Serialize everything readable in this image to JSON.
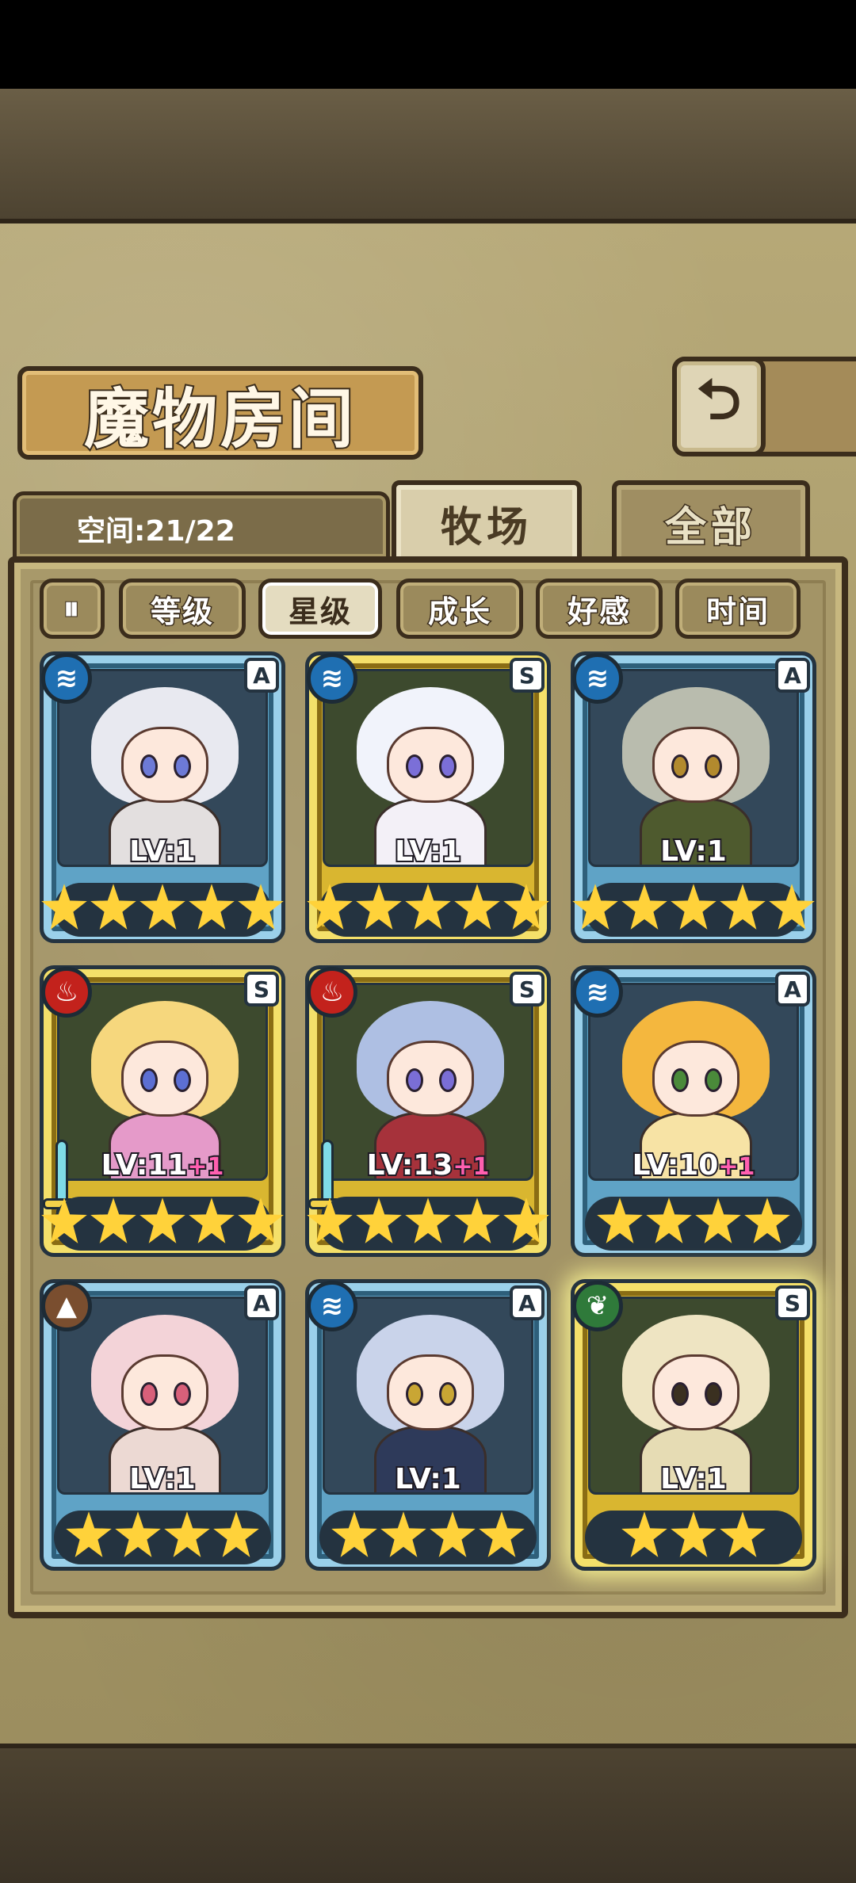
{
  "screen": {
    "title": "魔物房间",
    "back_icon": "back-arrow-icon"
  },
  "capacity": {
    "label": "空间:21/22"
  },
  "tabs": [
    {
      "label": "牧场",
      "active": true
    },
    {
      "label": "全部",
      "active": false
    }
  ],
  "sort": {
    "order_icon": "sort-order-icon",
    "order_glyph": "⏸",
    "buttons": [
      {
        "label": "等级",
        "active": false
      },
      {
        "label": "星级",
        "active": true
      },
      {
        "label": "成长",
        "active": false
      },
      {
        "label": "好感",
        "active": false
      },
      {
        "label": "时间",
        "active": false
      }
    ]
  },
  "monsters": [
    {
      "level": "LV:1",
      "bonus": "",
      "stars": 5,
      "rank": "A",
      "element": "water",
      "element_glyph": "≋",
      "frame": "blue",
      "has_weapon": false,
      "hair_color": "#e8e9f0",
      "outfit_color": "#e3dfdf",
      "eye_color": "#6d7ad6"
    },
    {
      "level": "LV:1",
      "bonus": "",
      "stars": 5,
      "rank": "S",
      "element": "water",
      "element_glyph": "≋",
      "frame": "gold",
      "has_weapon": false,
      "hair_color": "#f1f3fb",
      "outfit_color": "#f3f0f7",
      "eye_color": "#7b6fd8"
    },
    {
      "level": "LV:1",
      "bonus": "",
      "stars": 5,
      "rank": "A",
      "element": "water",
      "element_glyph": "≋",
      "frame": "blue",
      "has_weapon": false,
      "hair_color": "#b9bcae",
      "outfit_color": "#4e5a2e",
      "eye_color": "#b28a2e"
    },
    {
      "level": "LV:11",
      "bonus": "+1",
      "stars": 5,
      "rank": "S",
      "element": "fire",
      "element_glyph": "♨",
      "frame": "gold",
      "has_weapon": true,
      "hair_color": "#f6d77d",
      "outfit_color": "#e59ac9",
      "eye_color": "#5c6fd3"
    },
    {
      "level": "LV:13",
      "bonus": "+1",
      "stars": 5,
      "rank": "S",
      "element": "fire",
      "element_glyph": "♨",
      "frame": "gold",
      "has_weapon": true,
      "hair_color": "#aebfe3",
      "outfit_color": "#a6323b",
      "eye_color": "#7a6ed6"
    },
    {
      "level": "LV:10",
      "bonus": "+1",
      "stars": 4,
      "rank": "A",
      "element": "water",
      "element_glyph": "≋",
      "frame": "blue",
      "has_weapon": false,
      "hair_color": "#f4b73e",
      "outfit_color": "#f7e3a5",
      "eye_color": "#4a8a3a"
    },
    {
      "level": "LV:1",
      "bonus": "",
      "stars": 4,
      "rank": "A",
      "element": "earth",
      "element_glyph": "▲",
      "frame": "blue",
      "has_weapon": false,
      "hair_color": "#f3d3d8",
      "outfit_color": "#ecd9d3",
      "eye_color": "#d8607a"
    },
    {
      "level": "LV:1",
      "bonus": "",
      "stars": 4,
      "rank": "A",
      "element": "water",
      "element_glyph": "≋",
      "frame": "blue",
      "has_weapon": false,
      "hair_color": "#c9d3ea",
      "outfit_color": "#2e3a5a",
      "eye_color": "#c9a634"
    },
    {
      "level": "LV:1",
      "bonus": "",
      "stars": 3,
      "rank": "S",
      "element": "wood",
      "element_glyph": "❦",
      "frame": "gold",
      "has_weapon": false,
      "hair_color": "#eee4c2",
      "outfit_color": "#e6dcb4",
      "eye_color": "#3a3020"
    }
  ]
}
